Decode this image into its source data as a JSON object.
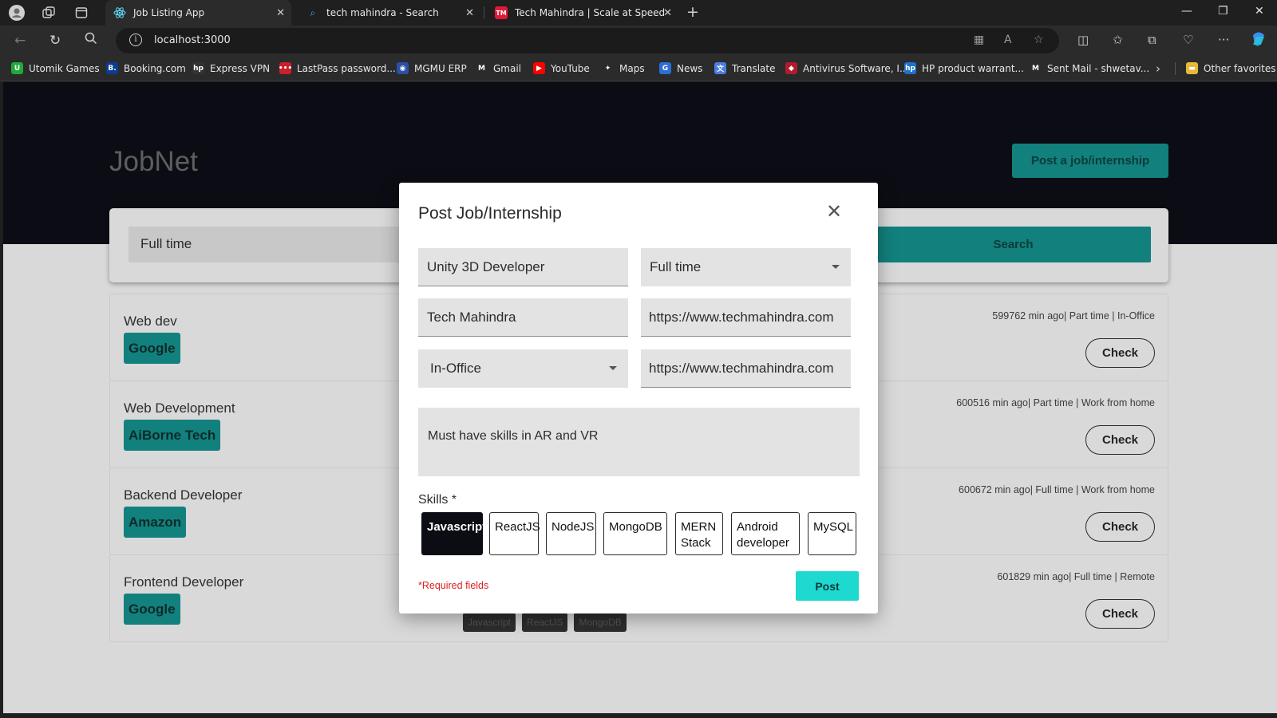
{
  "browser": {
    "tabs": [
      {
        "title": "Job Listing App",
        "active": true
      },
      {
        "title": "tech mahindra - Search",
        "active": false
      },
      {
        "title": "Tech Mahindra | Scale at Speed",
        "active": false
      }
    ],
    "url": "localhost:3000",
    "bookmarks": [
      {
        "label": "Utomik Games",
        "icon_color": "#1faa3a",
        "glyph": "U"
      },
      {
        "label": "Booking.com",
        "icon_color": "#0a3d8f",
        "glyph": "B."
      },
      {
        "label": "Express VPN",
        "icon_color": "#333333",
        "glyph": "hp"
      },
      {
        "label": "LastPass password...",
        "icon_color": "#cc1f2b",
        "glyph": "•••"
      },
      {
        "label": "MGMU ERP",
        "icon_color": "#2b4fa8",
        "glyph": "◉"
      },
      {
        "label": "Gmail",
        "icon_color": "#2b2b2b",
        "glyph": "M"
      },
      {
        "label": "YouTube",
        "icon_color": "#ff0000",
        "glyph": "▶"
      },
      {
        "label": "Maps",
        "icon_color": "#2b2b2b",
        "glyph": "✦"
      },
      {
        "label": "News",
        "icon_color": "#2b6fd6",
        "glyph": "G"
      },
      {
        "label": "Translate",
        "icon_color": "#4a7fe0",
        "glyph": "文"
      },
      {
        "label": "Antivirus Software, I...",
        "icon_color": "#b01c2e",
        "glyph": "◆"
      },
      {
        "label": "HP product warrant...",
        "icon_color": "#1e73c9",
        "glyph": "hp"
      },
      {
        "label": "Sent Mail - shwetav...",
        "icon_color": "#2b2b2b",
        "glyph": "M"
      },
      {
        "label": "Other favorites",
        "icon_color": "#e8b83a",
        "glyph": "▬"
      }
    ]
  },
  "page": {
    "brand": "JobNet",
    "post_job_button": "Post a job/internship",
    "search_field_value": "Full time",
    "search_button": "Search",
    "check_label": "Check",
    "jobs": [
      {
        "title": "Web dev",
        "company": "Google",
        "meta": "599762 min ago| Part time | In-Office"
      },
      {
        "title": "Web Development",
        "company": "AiBorne Tech",
        "meta": "600516 min ago| Part time | Work from home"
      },
      {
        "title": "Backend Developer",
        "company": "Amazon",
        "meta": "600672 min ago| Full time | Work from home"
      },
      {
        "title": "Frontend Developer",
        "company": "Google",
        "meta": "601829 min ago| Full time | Remote",
        "skills": [
          "Javascript",
          "ReactJS",
          "MongoDB"
        ]
      }
    ]
  },
  "modal": {
    "title": "Post Job/Internship",
    "job_title_value": "Unity 3D Developer",
    "job_type_value": "Full time",
    "company_value": "Tech Mahindra",
    "company_url_value": "https://www.techmahindra.com",
    "location_type_value": "In-Office",
    "apply_link_value": "https://www.techmahindra.com",
    "description_value": "Must have skills in AR and VR",
    "skills_label": "Skills *",
    "skills": [
      {
        "label": "Javascript",
        "selected": true
      },
      {
        "label": "ReactJS",
        "selected": false
      },
      {
        "label": "NodeJS",
        "selected": false
      },
      {
        "label": "MongoDB",
        "selected": false
      },
      {
        "label": "MERN Stack",
        "selected": false
      },
      {
        "label": "Android developer",
        "selected": false
      },
      {
        "label": "MySQL",
        "selected": false
      }
    ],
    "required_note": "*Required fields",
    "post_button": "Post"
  },
  "colors": {
    "accent": "#12807c",
    "post_button": "#1ed9d0",
    "hero_bg": "#0c0c14",
    "required": "#e02020"
  }
}
